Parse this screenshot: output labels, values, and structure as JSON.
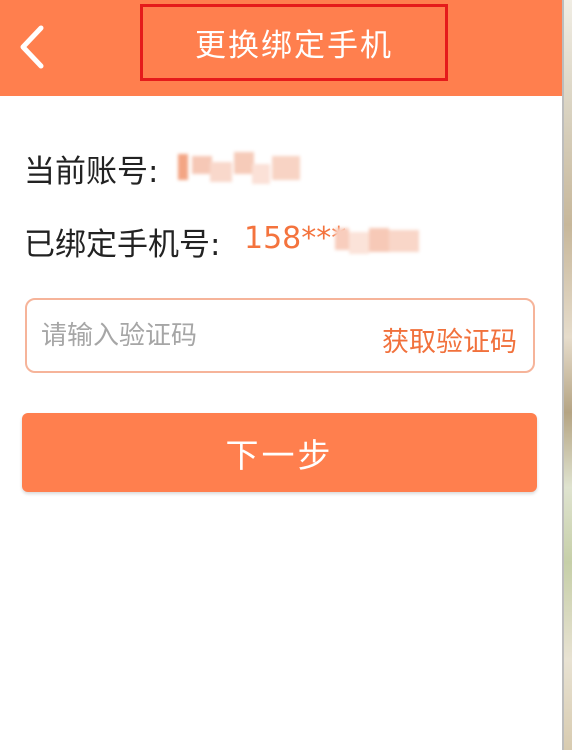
{
  "header": {
    "title": "更换绑定手机",
    "back_icon": "chevron-left-icon"
  },
  "account": {
    "label": "当前账号:",
    "value": "redacted"
  },
  "bound_phone": {
    "label": "已绑定手机号:",
    "value_visible": "158***",
    "value_hidden": "redacted"
  },
  "verification": {
    "placeholder": "请输入验证码",
    "get_code_label": "获取验证码"
  },
  "actions": {
    "next_label": "下一步"
  },
  "colors": {
    "accent": "#ff7f4e",
    "accent_text": "#f1713c",
    "input_border": "#f6b49a",
    "highlight_box": "#e51b1b"
  }
}
